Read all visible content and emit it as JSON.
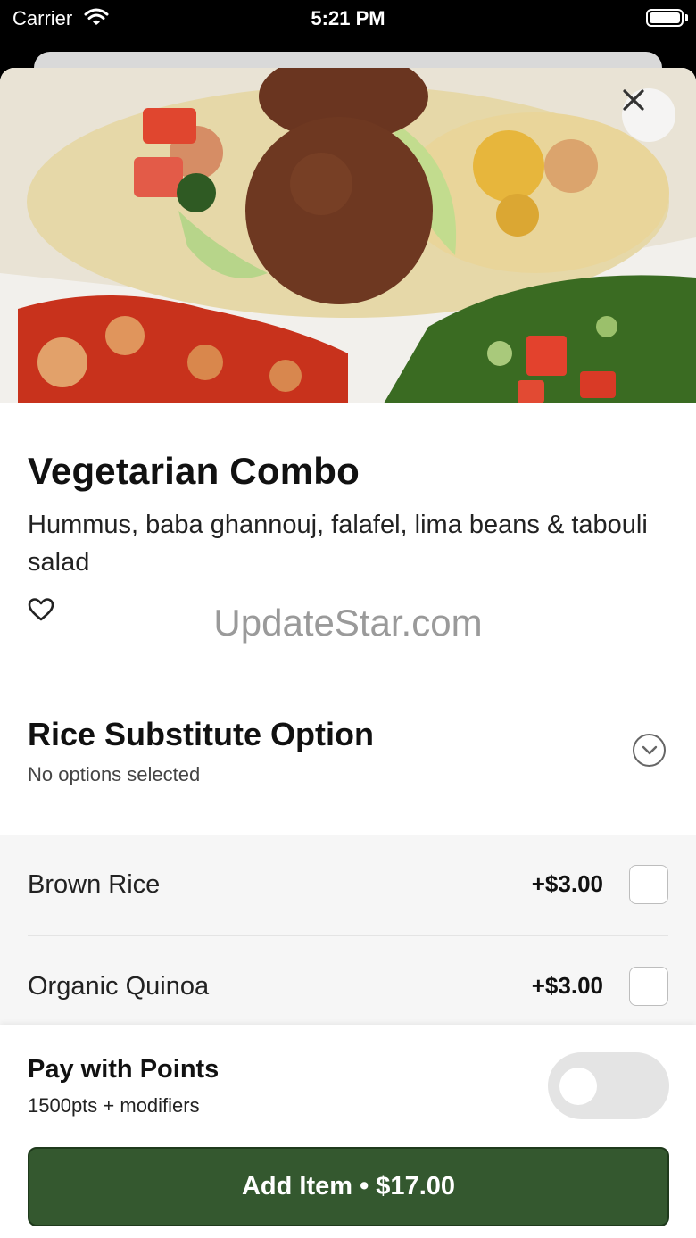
{
  "status_bar": {
    "carrier": "Carrier",
    "time": "5:21 PM"
  },
  "item": {
    "title": "Vegetarian Combo",
    "description": "Hummus, baba ghannouj, falafel, lima beans & tabouli salad",
    "favorite_icon": "heart-outline-icon",
    "image_alt": "food-photo"
  },
  "watermark": "UpdateStar.com",
  "option_group": {
    "title": "Rice Substitute Option",
    "subtitle": "No options selected",
    "options": [
      {
        "label": "Brown Rice",
        "price": "+$3.00",
        "checked": false
      },
      {
        "label": "Organic Quinoa",
        "price": "+$3.00",
        "checked": false
      }
    ]
  },
  "footer": {
    "points_title": "Pay with Points",
    "points_subtitle": "1500pts + modifiers",
    "points_enabled": false,
    "add_button_label": "Add Item • $17.00"
  },
  "colors": {
    "primary": "#34582f",
    "toggle_off": "#e4e4e4"
  }
}
